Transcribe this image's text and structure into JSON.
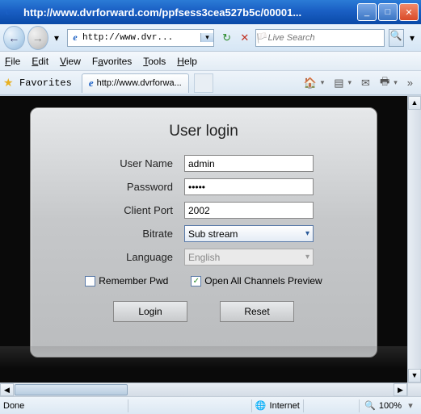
{
  "titlebar": {
    "url_text": "http://www.dvrforward.com/ppfsess3cea527b5c/00001..."
  },
  "navbar": {
    "address_value": "http://www.dvr...",
    "search_placeholder": "Live Search"
  },
  "menubar": {
    "file": "File",
    "edit": "Edit",
    "view": "View",
    "favorites": "Favorites",
    "tools": "Tools",
    "help": "Help"
  },
  "favbar": {
    "favorites_label": "Favorites",
    "tab_label": "http://www.dvrforwa..."
  },
  "login": {
    "title": "User login",
    "labels": {
      "username": "User Name",
      "password": "Password",
      "client_port": "Client Port",
      "bitrate": "Bitrate",
      "language": "Language"
    },
    "values": {
      "username": "admin",
      "password": "•••••",
      "client_port": "2002",
      "bitrate": "Sub stream",
      "language": "English"
    },
    "checkboxes": {
      "remember": "Remember Pwd",
      "open_all": "Open All Channels Preview"
    },
    "buttons": {
      "login": "Login",
      "reset": "Reset"
    }
  },
  "statusbar": {
    "left": "Done",
    "zone": "Internet",
    "zoom": "100%"
  },
  "icons": {
    "min": "_",
    "max": "□",
    "close": "✕",
    "back": "←",
    "fwd": "→",
    "dropdown": "▾",
    "refresh": "↻",
    "stop": "✕",
    "search": "🔍",
    "star": "★",
    "ie": "e",
    "home": "🏠",
    "rss": "▤",
    "mail": "✉",
    "print": "🖶",
    "chev": "▾",
    "globe": "🌐",
    "sel_arrow": "▾",
    "check": "✓",
    "up": "▲",
    "down": "▼",
    "left": "◀",
    "right": "▶"
  }
}
